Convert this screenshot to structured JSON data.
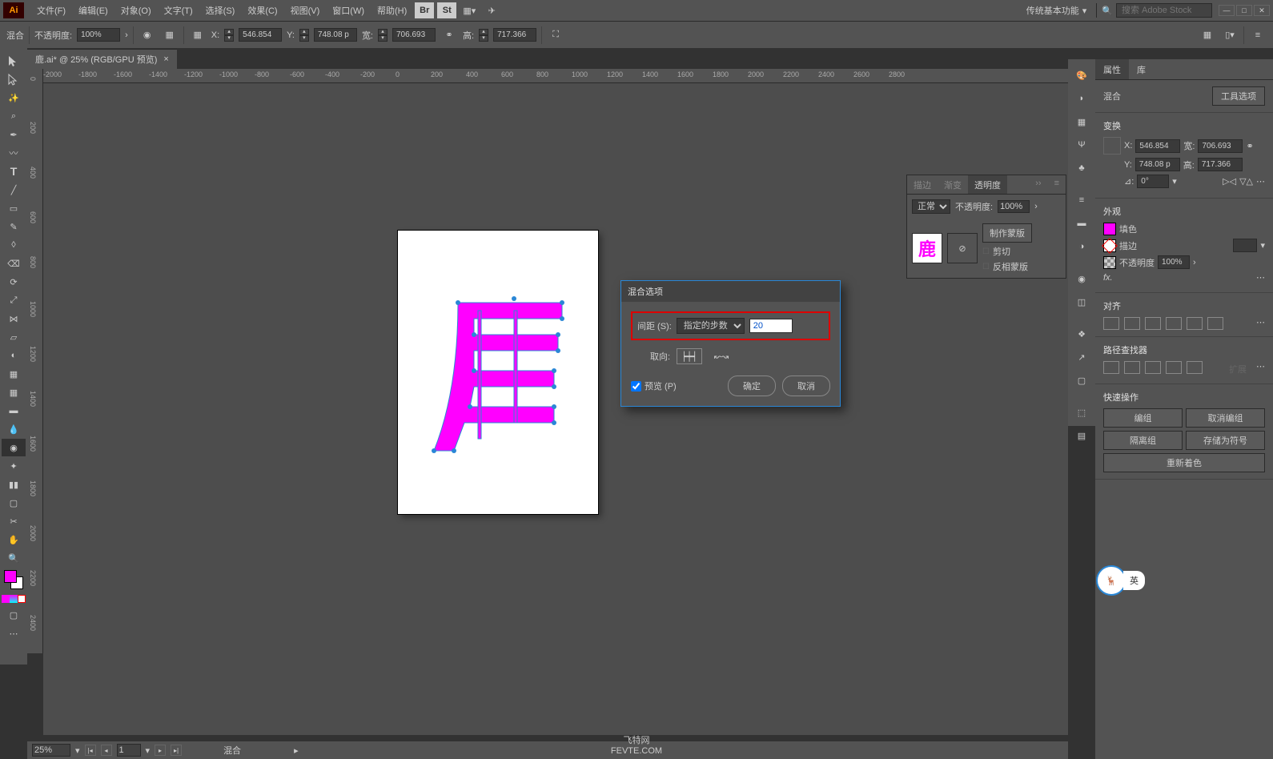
{
  "menu": {
    "logo": "Ai",
    "items": [
      "文件(F)",
      "编辑(E)",
      "对象(O)",
      "文字(T)",
      "选择(S)",
      "效果(C)",
      "视图(V)",
      "窗口(W)",
      "帮助(H)"
    ],
    "workspace": "传统基本功能",
    "search_placeholder": "搜索 Adobe Stock"
  },
  "optionbar": {
    "tool": "混合",
    "opacity_label": "不透明度:",
    "opacity_value": "100%",
    "x_label": "X:",
    "x_value": "546.854",
    "y_label": "Y:",
    "y_value": "748.08 p",
    "w_label": "宽:",
    "w_value": "706.693",
    "h_label": "高:",
    "h_value": "717.366"
  },
  "tab": {
    "name": "鹿.ai* @ 25% (RGB/GPU 预览)"
  },
  "ruler_h": [
    "-2000",
    "-1800",
    "-1600",
    "-1400",
    "-1200",
    "-1000",
    "-800",
    "-600",
    "-400",
    "-200",
    "0",
    "200",
    "400",
    "600",
    "800",
    "1000",
    "1200",
    "1400",
    "1600",
    "1800",
    "2000",
    "2200",
    "2400",
    "2600",
    "2800"
  ],
  "ruler_v": [
    "0",
    "200",
    "400",
    "600",
    "800",
    "1000",
    "1200",
    "1400",
    "1600",
    "1800",
    "2000",
    "2200",
    "2400"
  ],
  "statusbar": {
    "zoom": "25%",
    "artboard": "1",
    "tool": "混合"
  },
  "transparency": {
    "tabs": [
      "描边",
      "渐变",
      "透明度"
    ],
    "mode": "正常",
    "opacity_label": "不透明度:",
    "opacity": "100%",
    "make_mask": "制作蒙版",
    "clip": "剪切",
    "invert": "反相蒙版",
    "thumb_char": "鹿"
  },
  "dialog": {
    "title": "混合选项",
    "spacing_label": "间距 (S):",
    "spacing_mode": "指定的步数",
    "spacing_value": "20",
    "orient_label": "取向:",
    "preview": "预览 (P)",
    "ok": "确定",
    "cancel": "取消"
  },
  "prop": {
    "tabs": [
      "属性",
      "库"
    ],
    "obj_type": "混合",
    "tool_options": "工具选项",
    "transform_hdr": "变换",
    "x_label": "X:",
    "x": "546.854",
    "w_label": "宽:",
    "w": "706.693",
    "y_label": "Y:",
    "y": "748.08 p",
    "h_label": "高:",
    "h": "717.366",
    "angle_label": "⊿:",
    "angle": "0°",
    "appearance_hdr": "外观",
    "fill": "填色",
    "stroke": "描边",
    "opacity_label": "不透明度",
    "opacity": "100%",
    "fx": "fx.",
    "align_hdr": "对齐",
    "pathfinder_hdr": "路径查找器",
    "expand": "扩展",
    "quick_hdr": "快速操作",
    "group": "编组",
    "ungroup": "取消编组",
    "isolate": "隔离组",
    "save_symbol": "存储为符号",
    "recolor": "重新着色"
  },
  "ime": {
    "label": "英"
  },
  "footer": {
    "l1": "飞特网",
    "l2": "FEVTE.COM"
  },
  "colors": {
    "magenta": "#ff00ff"
  }
}
